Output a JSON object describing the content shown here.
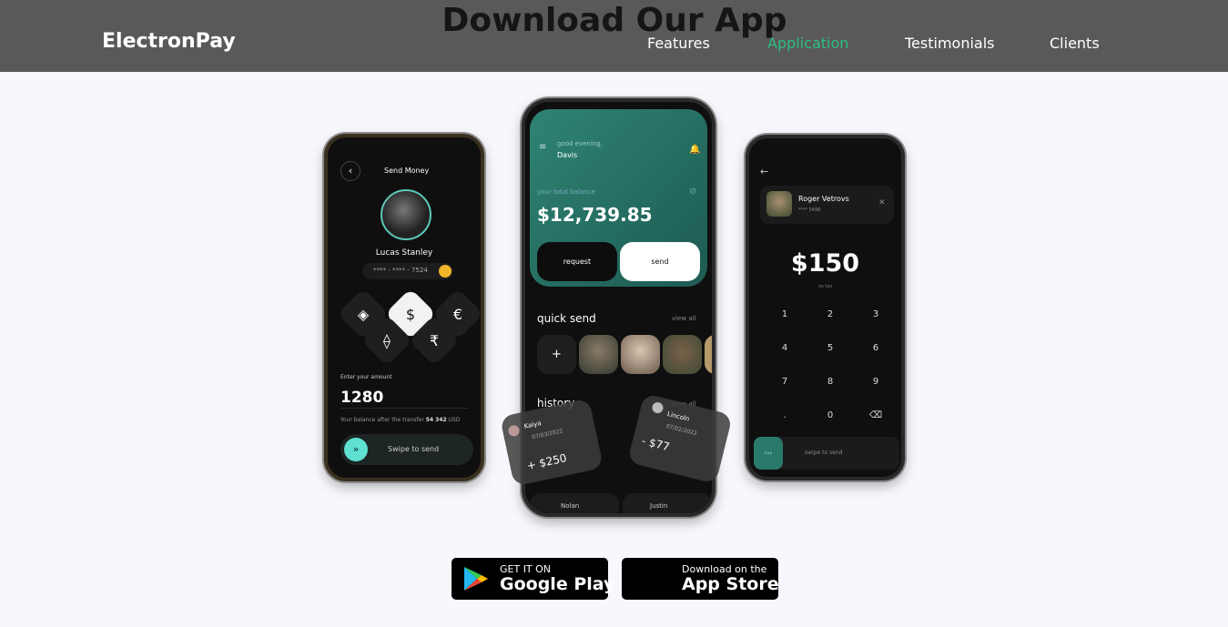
{
  "header": {
    "brand": "ElectronPay",
    "title": "Download Our App",
    "nav": [
      {
        "label": "Features"
      },
      {
        "label": "Application"
      },
      {
        "label": "Testimonials"
      },
      {
        "label": "Clients"
      }
    ],
    "accent": "#2ebf7e"
  },
  "left_phone": {
    "title": "Send Money",
    "name": "Lucas Stanley",
    "card": "**** - **** - 7524",
    "currencies": [
      "binance-icon",
      "dollar-icon",
      "euro-icon",
      "ethereum-icon",
      "rupee-icon"
    ],
    "amount_label": "Enter your amount",
    "amount": "1280",
    "balance_prefix": "Your balance after the transfer",
    "balance_value": "54 342",
    "balance_unit": "USD",
    "swipe": "Swipe to send"
  },
  "center_phone": {
    "greeting": "good evening,",
    "user": "Davis",
    "balance_label": "your total balance",
    "balance": "$12,739.85",
    "request": "request",
    "send": "send",
    "quick_send": "quick send",
    "view_all": "view all",
    "history": "history",
    "history_view_all": "view all",
    "cards": [
      {
        "name": "Kaiya",
        "date": "07/03/2022",
        "amount": "+ $250"
      },
      {
        "name": "Lincoln",
        "date": "07/02/2022",
        "amount": "- $77"
      }
    ],
    "bottom": [
      "Nolan",
      "Justin"
    ],
    "teal": "#2d7a6c"
  },
  "right_phone": {
    "name": "Roger Vetrovs",
    "card": "**** 5498",
    "amount": "$150",
    "note": "no tax",
    "keys": [
      "1",
      "2",
      "3",
      "4",
      "5",
      "6",
      "7",
      "8",
      "9",
      ".",
      "0",
      "⌫"
    ],
    "swipe": "swipe to send"
  },
  "badges": {
    "google_small": "GET IT ON",
    "google_big": "Google Play",
    "apple_small": "Download on the",
    "apple_big": "App Store"
  }
}
